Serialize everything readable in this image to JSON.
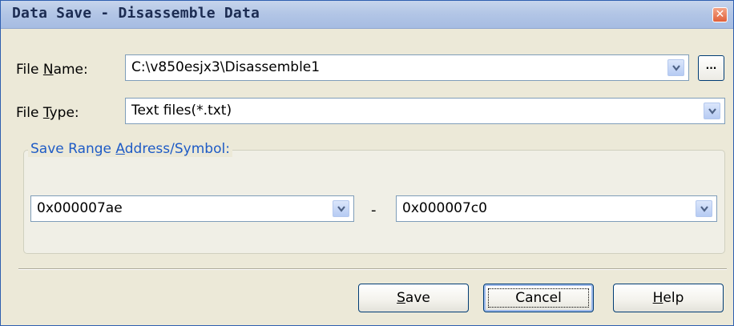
{
  "window": {
    "title": "Data Save - Disassemble Data",
    "close_glyph": "✕"
  },
  "file_name": {
    "label_pre": "File ",
    "label_key": "N",
    "label_post": "ame:",
    "value": "C:\\v850esjx3\\Disassemble1",
    "browse_label": "..."
  },
  "file_type": {
    "label_pre": "File ",
    "label_key": "T",
    "label_post": "ype:",
    "value": "Text files(*.txt)"
  },
  "save_range": {
    "label_pre": "Save Range ",
    "label_key": "A",
    "label_post": "ddress/Symbol:",
    "start": "0x000007ae",
    "separator": "-",
    "end": "0x000007c0"
  },
  "buttons": {
    "save": {
      "pre": "",
      "key": "S",
      "post": "ave"
    },
    "cancel": {
      "label": "Cancel"
    },
    "help": {
      "pre": "",
      "key": "H",
      "post": "elp"
    }
  }
}
